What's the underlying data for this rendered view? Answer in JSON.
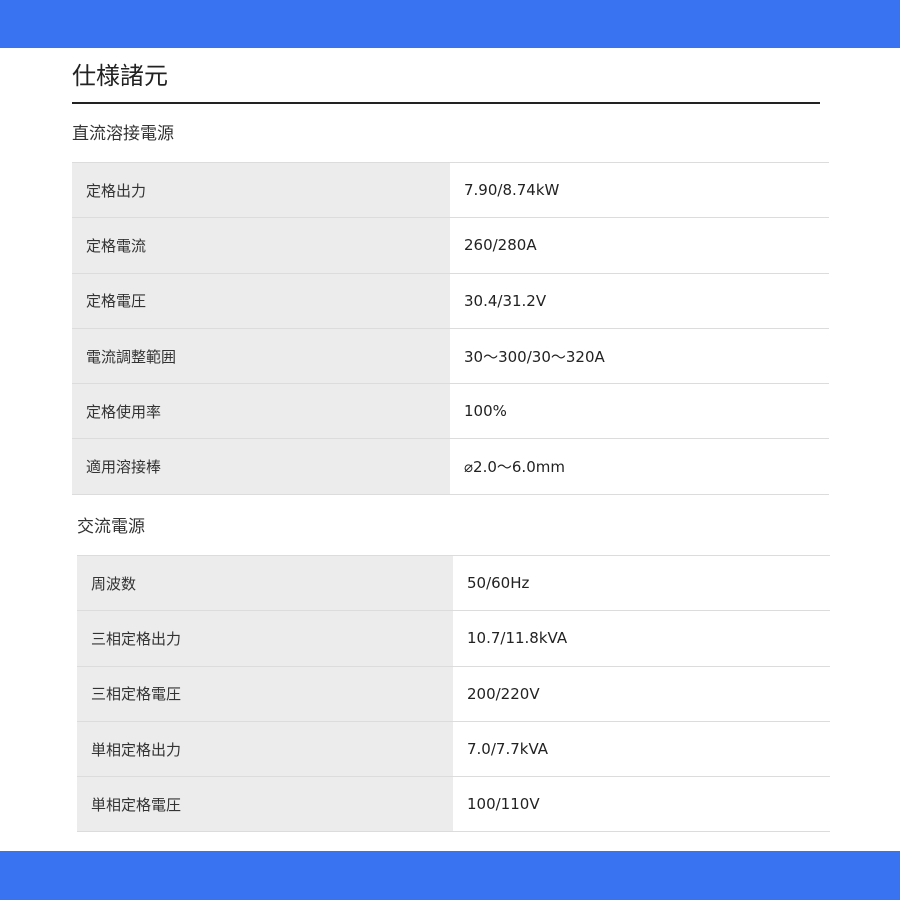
{
  "page_title": "仕様諸元",
  "colors": {
    "band": "#3a73f2",
    "label_bg": "#ececec",
    "rule": "#222222"
  },
  "sections": [
    {
      "heading": "直流溶接電源",
      "rows": [
        {
          "label": "定格出力",
          "value": "7.90/8.74kW"
        },
        {
          "label": "定格電流",
          "value": "260/280A"
        },
        {
          "label": "定格電圧",
          "value": "30.4/31.2V"
        },
        {
          "label": "電流調整範囲",
          "value": "30～300/30～320A"
        },
        {
          "label": "定格使用率",
          "value": "100%"
        },
        {
          "label": "適用溶接棒",
          "value": "⌀2.0～6.0mm"
        }
      ]
    },
    {
      "heading": "交流電源",
      "rows": [
        {
          "label": "周波数",
          "value": "50/60Hz"
        },
        {
          "label": "三相定格出力",
          "value": "10.7/11.8kVA"
        },
        {
          "label": "三相定格電圧",
          "value": "200/220V"
        },
        {
          "label": "単相定格出力",
          "value": "7.0/7.7kVA"
        },
        {
          "label": "単相定格電圧",
          "value": "100/110V"
        }
      ]
    }
  ]
}
